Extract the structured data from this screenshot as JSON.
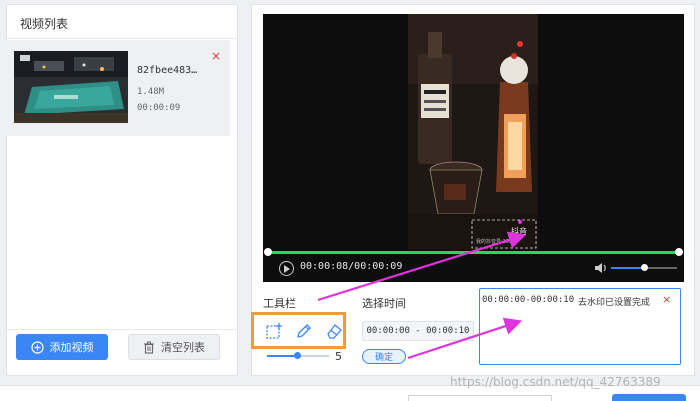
{
  "video_list": {
    "title": "视频列表",
    "items": [
      {
        "name": "82fbee483…",
        "size": "1.48M",
        "duration": "00:00:09",
        "remove_icon": "close-icon",
        "remove_symbol": "×"
      }
    ],
    "add_button": {
      "label": "添加视频",
      "icon": "plus-circle-icon"
    },
    "clear_button": {
      "label": "清空列表",
      "icon": "trash-icon"
    }
  },
  "player": {
    "time": "00:00:08/00:00:09",
    "progress": 0.99,
    "volume": 0.5,
    "frame_logo_text": "抖音",
    "frame_logo_sub": "我的抖音号:1588"
  },
  "toolbar": {
    "label": "工具栏",
    "tools": [
      {
        "name": "rect-select-icon"
      },
      {
        "name": "pencil-icon"
      },
      {
        "name": "eraser-icon"
      }
    ],
    "size_value": "5",
    "size_fraction": 0.48
  },
  "time_select": {
    "label": "选择时间",
    "range": "00:00:00 - 00:00:10",
    "confirm_label": "确定"
  },
  "results": [
    {
      "time": "00:00:00-00:00:10",
      "status": "去水印已设置完成",
      "remove_symbol": "×"
    }
  ],
  "watermark_text": "https://blog.csdn.net/qq_42763389",
  "colors": {
    "accent": "#3a86f5",
    "progress": "#29d45f",
    "highlight": "#f39a3c",
    "arrow": "#e033e0",
    "danger": "#e53935"
  }
}
